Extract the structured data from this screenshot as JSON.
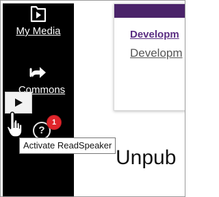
{
  "sidebar": {
    "items": [
      {
        "label": "My Media",
        "icon": "folder-play-icon"
      },
      {
        "label": "Commons",
        "icon": "share-arrow-icon"
      }
    ],
    "help_icon": "?",
    "notification_count": "1"
  },
  "readspeaker": {
    "button_icon": "play-icon",
    "tooltip": "Activate ReadSpeaker"
  },
  "card": {
    "title": "Developm",
    "subtitle": "Developm",
    "accent_color": "#4a2369"
  },
  "main": {
    "heading": "Unpub"
  }
}
